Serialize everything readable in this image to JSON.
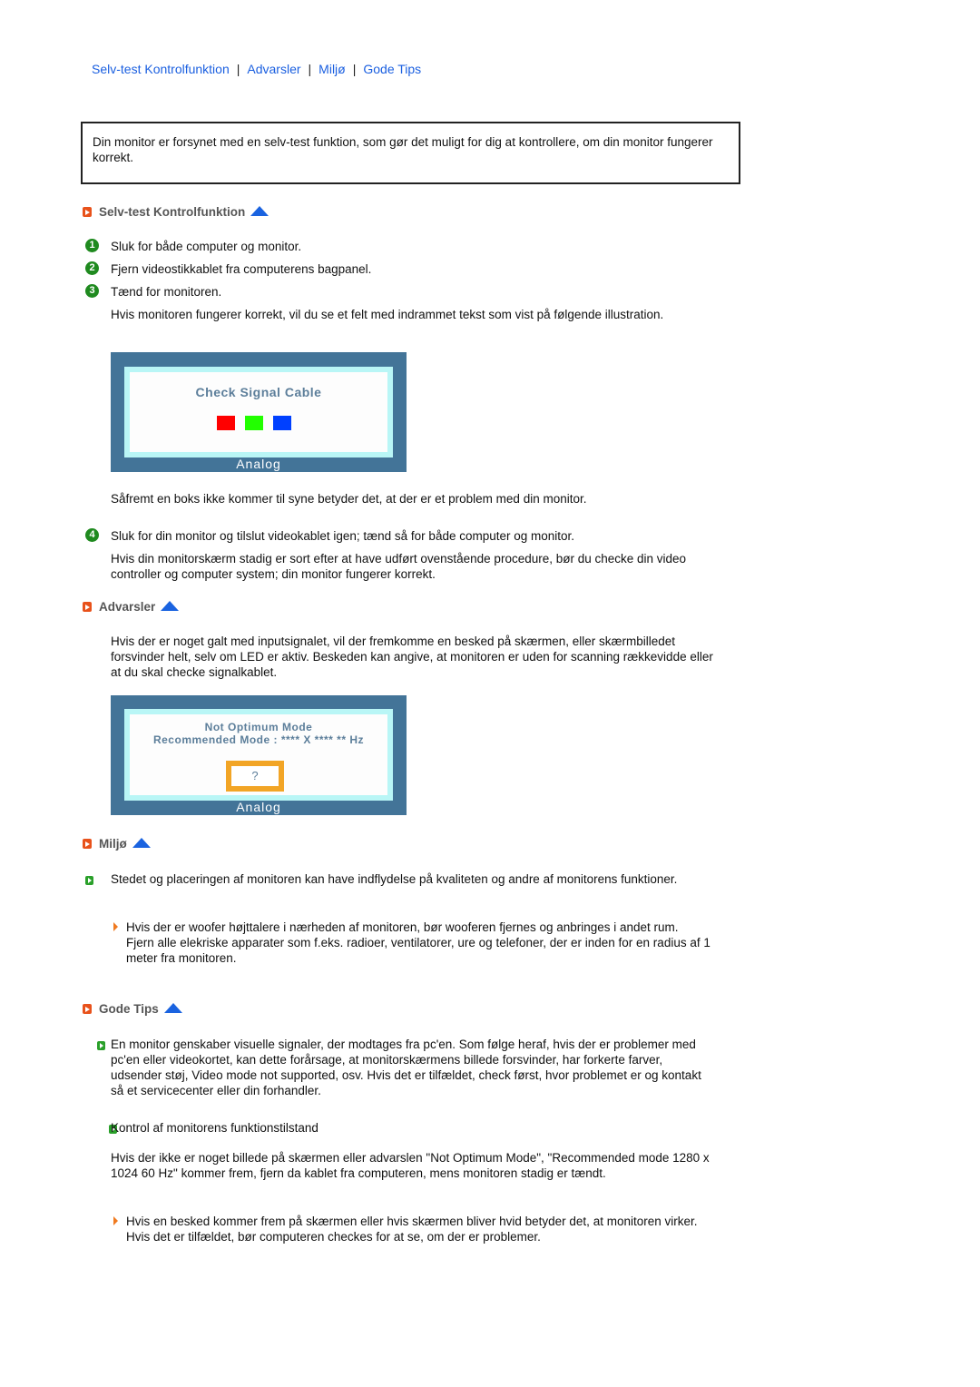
{
  "nav": {
    "links": [
      "Selv-test Kontrolfunktion",
      "Advarsler",
      "Miljø",
      "Gode Tips"
    ],
    "separator": "|"
  },
  "intro": "Din monitor er forsynet med en selv-test funktion, som gør det muligt for dig at kontrollere, om din monitor fungerer korrekt.",
  "sections": {
    "selftest": {
      "title": "Selv-test Kontrolfunktion",
      "steps": [
        {
          "num": "1",
          "text": "Sluk for både computer og monitor."
        },
        {
          "num": "2",
          "text": "Fjern videostikkablet fra computerens bagpanel."
        },
        {
          "num": "3",
          "text": "Tænd for monitoren."
        }
      ],
      "step3_note": "Hvis monitoren fungerer korrekt, vil du se et felt med indrammet tekst som vist på følgende illustration.",
      "osd": {
        "message": "Check Signal Cable",
        "label": "Analog",
        "colors": [
          "#ff0000",
          "#22ff00",
          "#0040ff"
        ]
      },
      "after_osd": "Såfremt en boks ikke kommer til syne betyder det, at der er et problem med din monitor.",
      "step4": {
        "num": "4",
        "text": "Sluk for din monitor og tilslut videokablet igen; tænd så for både computer og monitor."
      },
      "step4_note": "Hvis din monitorskærm stadig er sort efter at have udført ovenstående procedure, bør du checke din video controller og computer system; din monitor fungerer korrekt."
    },
    "warnings": {
      "title": "Advarsler",
      "text": "Hvis der er noget galt med inputsignalet, vil der fremkomme en besked på skærmen, eller skærmbilledet forsvinder helt, selv om LED er aktiv. Beskeden kan angive, at monitoren er uden for scanning rækkevidde eller at du skal checke signalkablet.",
      "osd": {
        "line1": "Not Optimum Mode",
        "line2": "Recommended Mode : **** X **** ** Hz",
        "question": "?",
        "label": "Analog"
      }
    },
    "environment": {
      "title": "Miljø",
      "item": "Stedet og placeringen af monitoren kan have indflydelse på kvaliteten og andre af monitorens funktioner.",
      "sub_item": "Hvis der er woofer højttalere i nærheden af monitoren, bør wooferen fjernes og anbringes i andet rum.",
      "sub_item_cont": "Fjern alle elekriske apparater som f.eks. radioer, ventilatorer, ure og telefoner, der er inden for en radius af 1 meter fra monitoren."
    },
    "tips": {
      "title": "Gode Tips",
      "item1": "En monitor genskaber visuelle signaler, der modtages fra pc'en. Som følge heraf, hvis der er problemer med pc'en eller videokortet, kan dette forårsage, at monitorskærmens billede forsvinder, har forkerte farver, udsender støj, Video mode not supported, osv. Hvis det er tilfældet, check først, hvor problemet er og kontakt så et servicecenter eller din forhandler.",
      "item2": "Kontrol af monitorens funktionstilstand",
      "item2_note": "Hvis der ikke er noget billede på skærmen eller advarslen \"Not Optimum Mode\", \"Recommended mode 1280 x 1024 60 Hz\" kommer frem, fjern da kablet fra computeren, mens monitoren stadig er tændt.",
      "sub_item": "Hvis en besked kommer frem på skærmen eller hvis skærmen bliver hvid betyder det, at monitoren virker.",
      "sub_item_cont": "Hvis det er tilfældet, bør computeren checkes for at se, om der er problemer."
    }
  }
}
